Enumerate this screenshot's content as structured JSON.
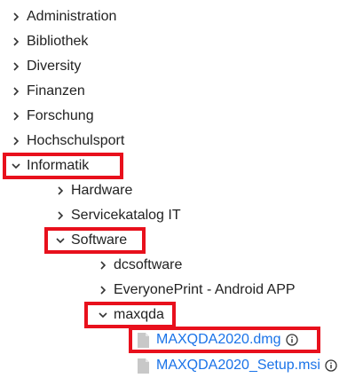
{
  "tree": {
    "items": [
      {
        "label": "Administration",
        "expanded": false
      },
      {
        "label": "Bibliothek",
        "expanded": false
      },
      {
        "label": "Diversity",
        "expanded": false
      },
      {
        "label": "Finanzen",
        "expanded": false
      },
      {
        "label": "Forschung",
        "expanded": false
      },
      {
        "label": "Hochschulsport",
        "expanded": false
      },
      {
        "label": "Informatik",
        "expanded": true
      },
      {
        "label": "Hardware",
        "expanded": false
      },
      {
        "label": "Servicekatalog IT",
        "expanded": false
      },
      {
        "label": "Software",
        "expanded": true
      },
      {
        "label": "dcsoftware",
        "expanded": false
      },
      {
        "label": "EveryonePrint - Android APP",
        "expanded": false
      },
      {
        "label": "maxqda",
        "expanded": true
      }
    ],
    "files": [
      {
        "label": "MAXQDA2020.dmg",
        "icon": "file-icon",
        "info_icon": "info-icon"
      },
      {
        "label": "MAXQDA2020_Setup.msi",
        "icon": "file-icon",
        "info_icon": "info-icon"
      }
    ]
  },
  "colors": {
    "text": "#222222",
    "link": "#1a73e8",
    "highlight": "#e8101c",
    "file_icon": "#c8c8c8"
  }
}
